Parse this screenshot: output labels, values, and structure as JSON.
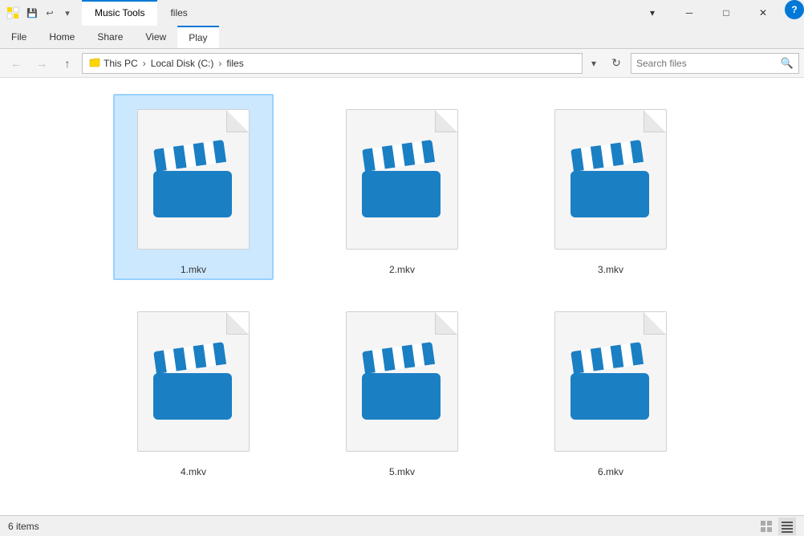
{
  "titleBar": {
    "appName": "files",
    "musicToolsLabel": "Music Tools",
    "tabs": [
      {
        "label": "File",
        "id": "file"
      },
      {
        "label": "Home",
        "id": "home"
      },
      {
        "label": "Share",
        "id": "share"
      },
      {
        "label": "View",
        "id": "view"
      },
      {
        "label": "Play",
        "id": "play",
        "active": true
      }
    ],
    "windowControls": {
      "minimize": "─",
      "maximize": "□",
      "close": "✕"
    }
  },
  "addressBar": {
    "path": [
      "This PC",
      "Local Disk (C:)",
      "files"
    ],
    "searchPlaceholder": "Search files",
    "searchLabel": "Search"
  },
  "files": [
    {
      "name": "1.mkv",
      "selected": true
    },
    {
      "name": "2.mkv",
      "selected": false
    },
    {
      "name": "3.mkv",
      "selected": false
    },
    {
      "name": "4.mkv",
      "selected": false
    },
    {
      "name": "5.mkv",
      "selected": false
    },
    {
      "name": "6.mkv",
      "selected": false
    }
  ],
  "statusBar": {
    "itemCount": "6 items"
  }
}
